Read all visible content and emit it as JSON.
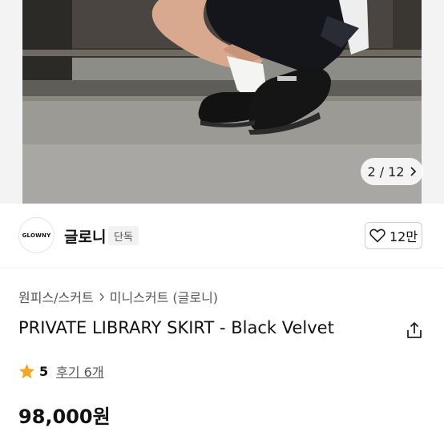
{
  "gallery": {
    "pager_text": "2 / 12",
    "icon": "chevron-right-icon"
  },
  "brand": {
    "logo_text": "GLOWNY",
    "name": "글로니",
    "badge": "단독",
    "like_count": "12만",
    "like_icon": "heart-outline-icon"
  },
  "breadcrumb": {
    "items": [
      "원피스/스커트",
      "미니스커트 (글로니)"
    ],
    "separator_icon": "chevron-right-icon"
  },
  "product": {
    "title": "PRIVATE LIBRARY SKIRT - Black Velvet",
    "share_icon": "share-icon"
  },
  "rating": {
    "score": "5",
    "reviews": "후기 6개",
    "star_color": "#F5A623"
  },
  "price": {
    "amount": "98,000원"
  }
}
